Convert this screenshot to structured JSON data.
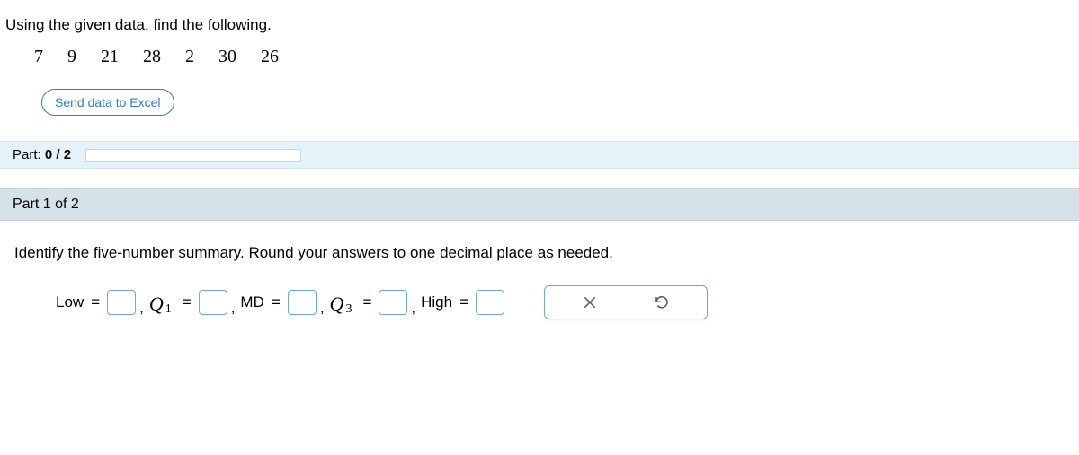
{
  "prompt": "Using the given data, find the following.",
  "data_values": [
    "7",
    "9",
    "21",
    "28",
    "2",
    "30",
    "26"
  ],
  "excel_button": "Send data to Excel",
  "progress": {
    "prefix": "Part: ",
    "value": "0 / 2"
  },
  "part_header": "Part 1 of 2",
  "instruction": "Identify the five-number summary. Round your answers to one decimal place as needed.",
  "labels": {
    "low": "Low",
    "q1_sym": "Q",
    "q1_sub": "1",
    "md": "MD",
    "q3_sym": "Q",
    "q3_sub": "3",
    "high": "High",
    "eq": "="
  },
  "inputs": {
    "low": "",
    "q1": "",
    "md": "",
    "q3": "",
    "high": ""
  }
}
